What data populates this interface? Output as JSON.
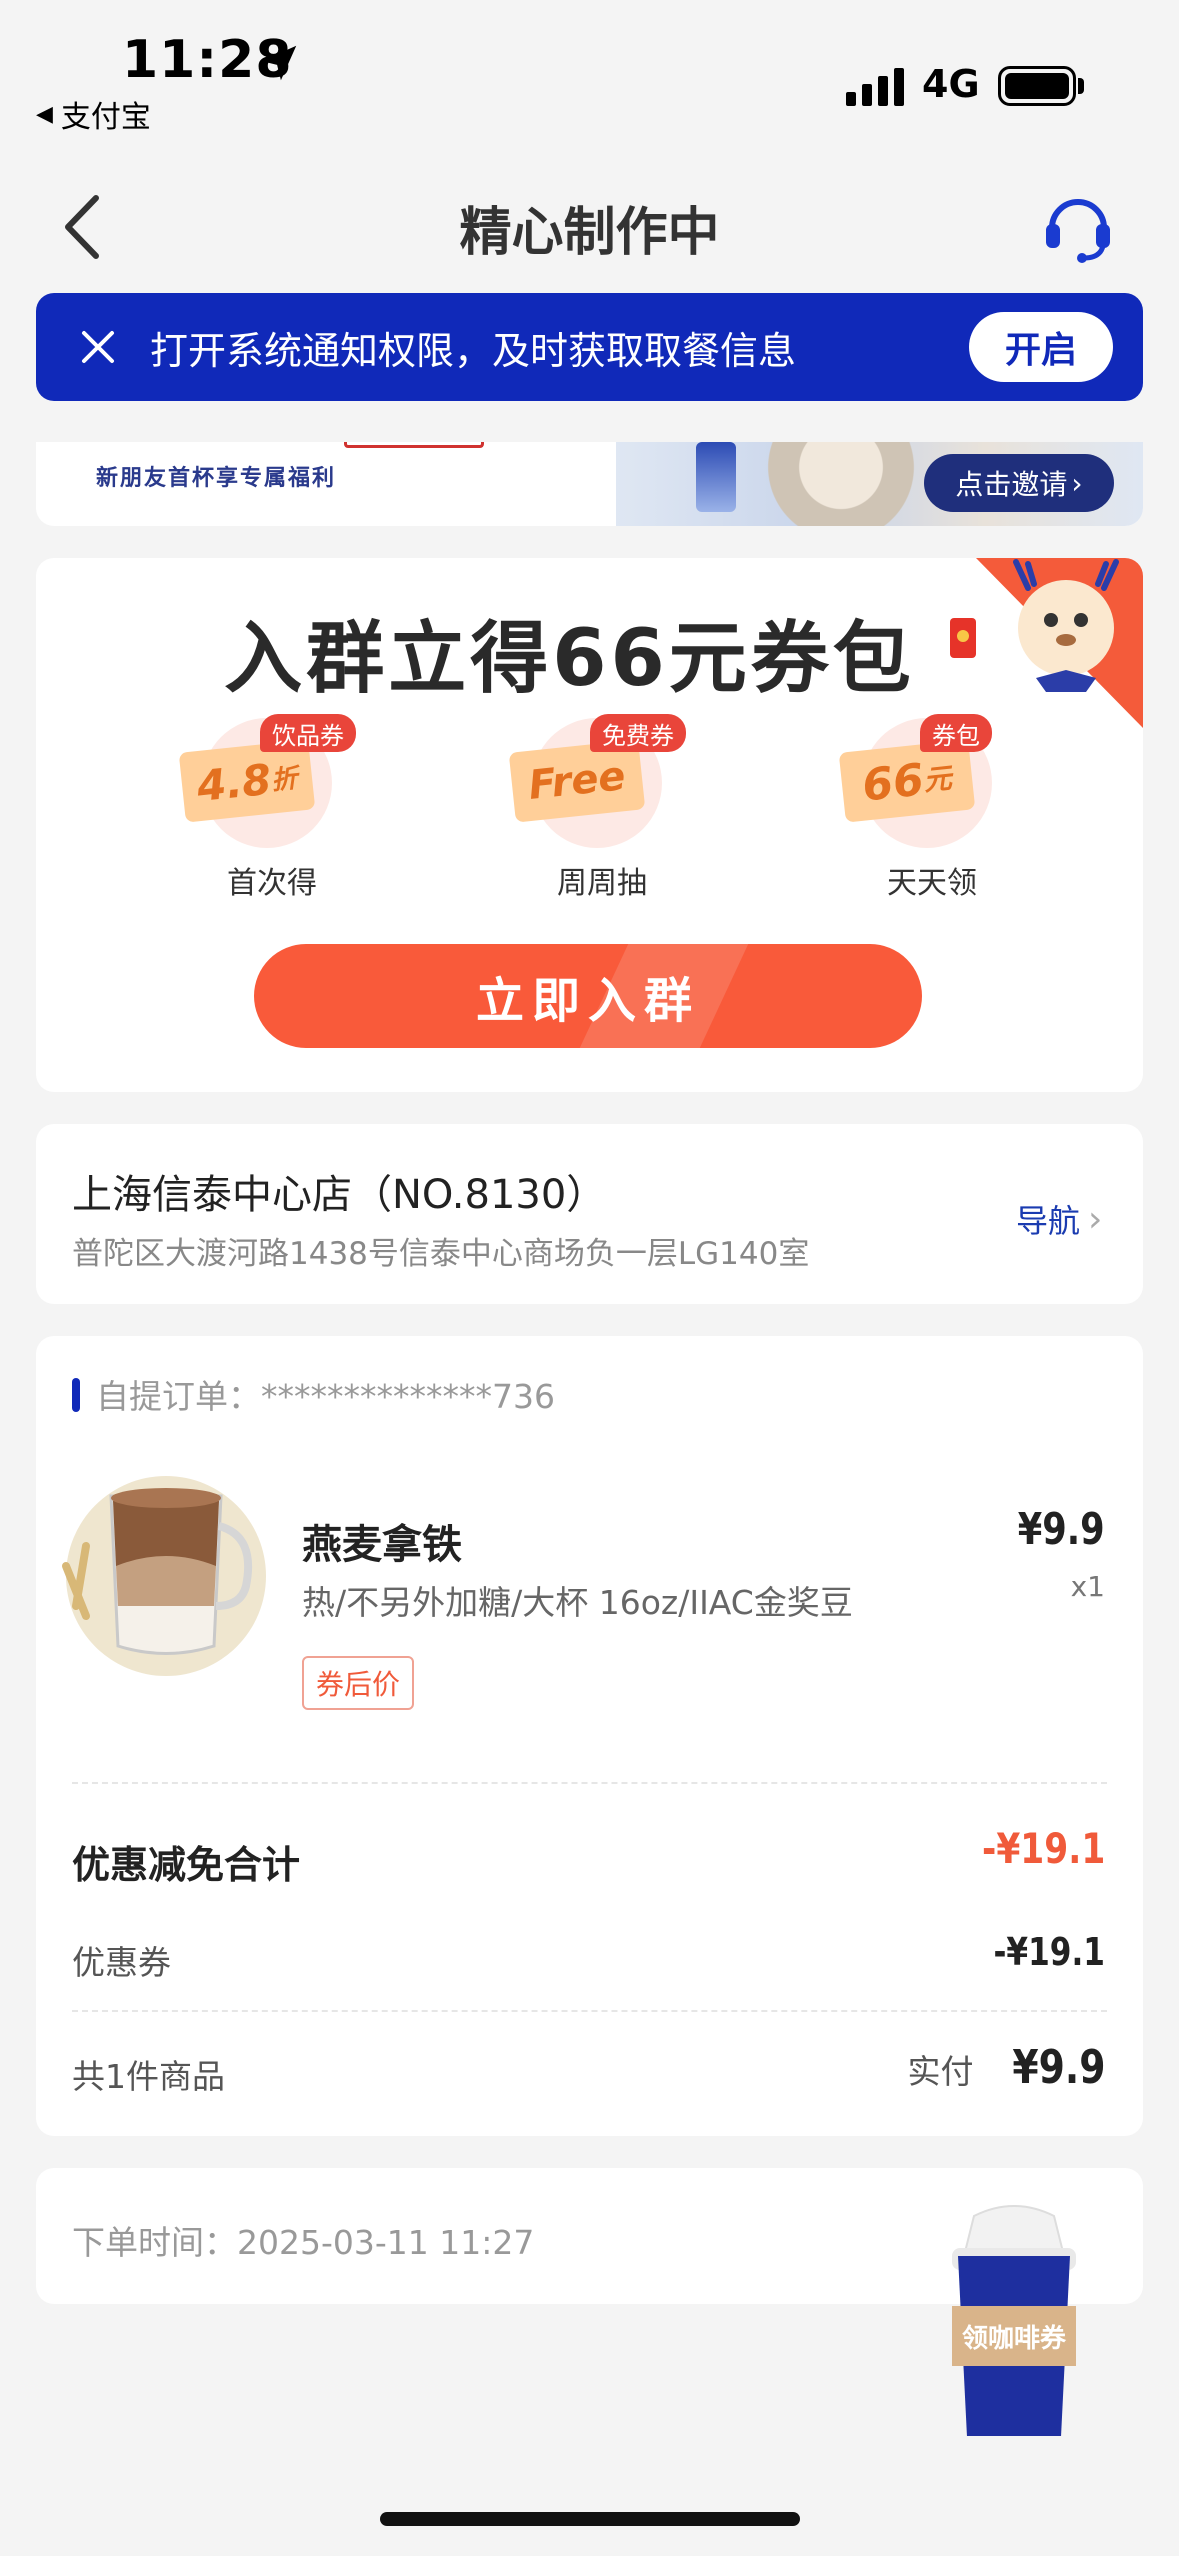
{
  "status": {
    "time": "11:28",
    "back_app": "支付宝",
    "network": "4G"
  },
  "header": {
    "title": "精心制作中"
  },
  "notice": {
    "text": "打开系统通知权限，及时获取取餐信息",
    "button": "开启",
    "bg_color": "#1029b9"
  },
  "invite": {
    "text": "新朋友首杯享专属福利",
    "button": "点击邀请"
  },
  "group": {
    "title": "入群立得66元券包",
    "coupons": [
      {
        "tag": "饮品券",
        "value": "4.8",
        "unit": "折",
        "label": "首次得"
      },
      {
        "tag": "免费券",
        "value": "Free",
        "unit": "",
        "label": "周周抽"
      },
      {
        "tag": "券包",
        "value": "66",
        "unit": "元",
        "label": "天天领"
      }
    ],
    "button": "立即入群",
    "button_color": "#f95a3a"
  },
  "store": {
    "name": "上海信泰中心店（NO.8130）",
    "address": "普陀区大渡河路1438号信泰中心商场负一层LG140室",
    "nav_label": "导航"
  },
  "order": {
    "id_label": "自提订单：",
    "id_value": "**************736",
    "product": {
      "name": "燕麦拿铁",
      "spec": "热/不另外加糖/大杯 16oz/IIAC金奖豆",
      "tag": "券后价",
      "price": "¥9.9",
      "qty": "x1"
    },
    "discount_total_label": "优惠减免合计",
    "discount_total_value": "-¥19.1",
    "coupon_label": "优惠券",
    "coupon_value": "-¥19.1",
    "count_label": "共1件商品",
    "paid_label": "实付",
    "paid_value": "¥9.9",
    "accent_color": "#f05a3a"
  },
  "time": {
    "label": "下单时间：",
    "value": "2025-03-11 11:27"
  },
  "float_coupon": {
    "label": "领咖啡券"
  }
}
